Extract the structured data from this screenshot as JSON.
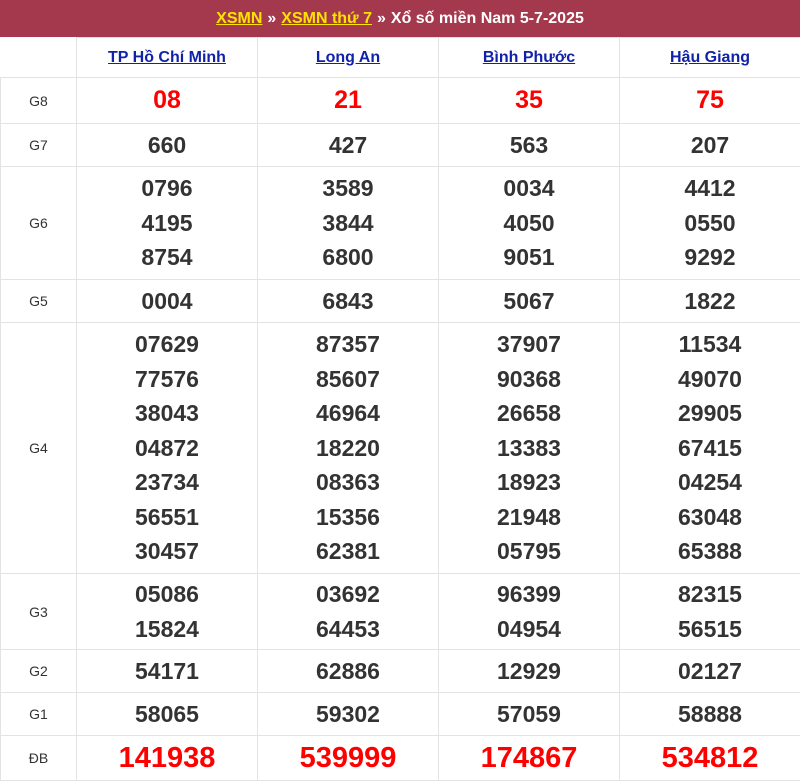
{
  "header": {
    "link1": "XSMN",
    "sep1": "»",
    "link2": "XSMN thứ 7",
    "sep2": "»",
    "title": "Xổ số miền Nam 5-7-2025",
    "bg_color": "#a4394d",
    "link_color": "#ffe300"
  },
  "provinces": [
    "TP Hồ Chí Minh",
    "Long An",
    "Bình Phước",
    "Hậu Giang"
  ],
  "prizes": [
    {
      "label": "G8",
      "style": "red",
      "values": [
        [
          "08"
        ],
        [
          "21"
        ],
        [
          "35"
        ],
        [
          "75"
        ]
      ]
    },
    {
      "label": "G7",
      "style": "normal",
      "values": [
        [
          "660"
        ],
        [
          "427"
        ],
        [
          "563"
        ],
        [
          "207"
        ]
      ]
    },
    {
      "label": "G6",
      "style": "normal",
      "values": [
        [
          "0796",
          "4195",
          "8754"
        ],
        [
          "3589",
          "3844",
          "6800"
        ],
        [
          "0034",
          "4050",
          "9051"
        ],
        [
          "4412",
          "0550",
          "9292"
        ]
      ]
    },
    {
      "label": "G5",
      "style": "normal",
      "values": [
        [
          "0004"
        ],
        [
          "6843"
        ],
        [
          "5067"
        ],
        [
          "1822"
        ]
      ]
    },
    {
      "label": "G4",
      "style": "normal",
      "values": [
        [
          "07629",
          "77576",
          "38043",
          "04872",
          "23734",
          "56551",
          "30457"
        ],
        [
          "87357",
          "85607",
          "46964",
          "18220",
          "08363",
          "15356",
          "62381"
        ],
        [
          "37907",
          "90368",
          "26658",
          "13383",
          "18923",
          "21948",
          "05795"
        ],
        [
          "11534",
          "49070",
          "29905",
          "67415",
          "04254",
          "63048",
          "65388"
        ]
      ]
    },
    {
      "label": "G3",
      "style": "normal",
      "values": [
        [
          "05086",
          "15824"
        ],
        [
          "03692",
          "64453"
        ],
        [
          "96399",
          "04954"
        ],
        [
          "82315",
          "56515"
        ]
      ]
    },
    {
      "label": "G2",
      "style": "normal",
      "values": [
        [
          "54171"
        ],
        [
          "62886"
        ],
        [
          "12929"
        ],
        [
          "02127"
        ]
      ]
    },
    {
      "label": "G1",
      "style": "normal",
      "values": [
        [
          "58065"
        ],
        [
          "59302"
        ],
        [
          "57059"
        ],
        [
          "58888"
        ]
      ]
    },
    {
      "label": "ĐB",
      "style": "db",
      "values": [
        [
          "141938"
        ],
        [
          "539999"
        ],
        [
          "174867"
        ],
        [
          "534812"
        ]
      ]
    }
  ],
  "colors": {
    "highlight": "#ff0000",
    "province_link": "#1122aa",
    "text": "#333333"
  }
}
